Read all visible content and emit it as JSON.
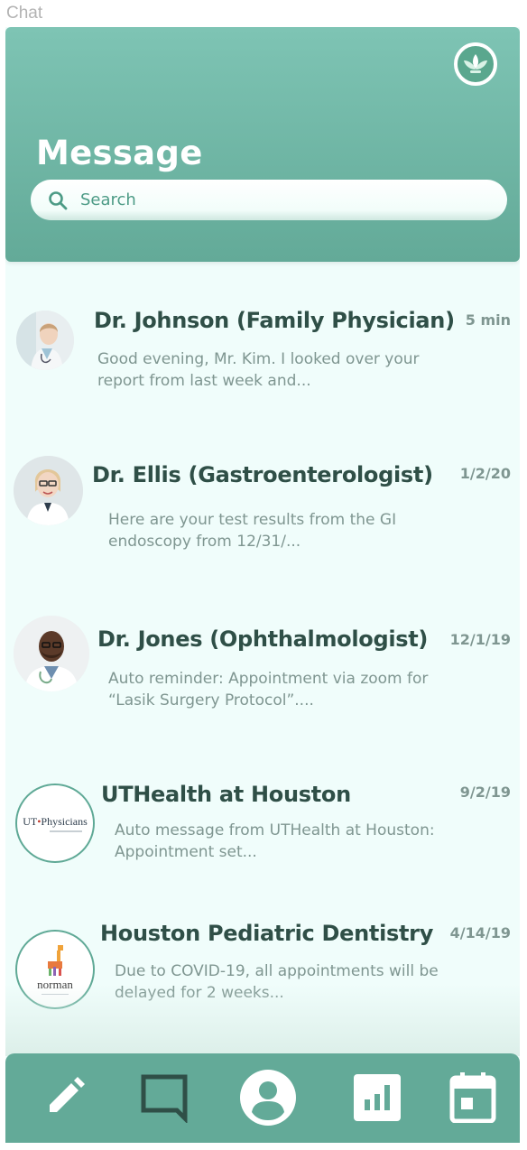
{
  "frame_label": "Chat",
  "header": {
    "title": "Message",
    "search_placeholder": "Search",
    "logo_icon": "leaf-logo-icon"
  },
  "conversations": [
    {
      "name": "Dr. Johnson (Family Physician)",
      "time": "5 min",
      "preview": "Good evening, Mr. Kim. I looked over your report from last week and..."
    },
    {
      "name": "Dr. Ellis (Gastroenterologist)",
      "time": "1/2/20",
      "preview": "Here are your test results from the GI endoscopy from 12/31/..."
    },
    {
      "name": "Dr. Jones (Ophthalmologist)",
      "time": "12/1/19",
      "preview": "Auto reminder: Appointment via zoom for “Lasik Surgery Protocol”...."
    },
    {
      "name": "UTHealth at Houston",
      "time": "9/2/19",
      "preview": "Auto message from UTHealth at Houston: Appointment set...",
      "logo_text": "UT",
      "logo_text2": "Physicians"
    },
    {
      "name": "Houston Pediatric Dentistry",
      "time": "4/14/19",
      "preview": "Due to COVID-19, all appointments will be delayed for 2 weeks...",
      "logo_text": "norman"
    }
  ],
  "nav": [
    "compose-icon",
    "chat-icon",
    "profile-icon",
    "stats-icon",
    "calendar-icon"
  ],
  "colors": {
    "header": "#63aa98",
    "background": "#f0fdfb",
    "name_text": "#2f4f47",
    "meta_text": "#7f9691",
    "accent": "#4d9b86"
  }
}
